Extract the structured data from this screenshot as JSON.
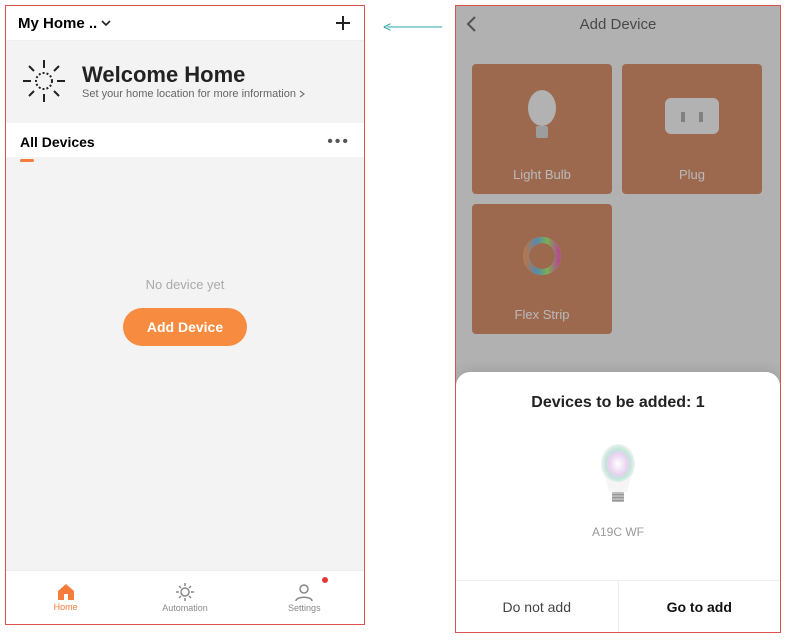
{
  "left": {
    "home_label": "My Home ..",
    "welcome_title": "Welcome Home",
    "welcome_subtitle": "Set your home location for more information",
    "tab": "All Devices",
    "empty_label": "No device yet",
    "add_button": "Add Device",
    "nav": {
      "home": "Home",
      "automation": "Automation",
      "settings": "Settings"
    }
  },
  "right": {
    "title": "Add Device",
    "tiles": [
      "Light Bulb",
      "Plug",
      "Flex Strip"
    ],
    "sheet_title": "Devices to be added: 1",
    "model": "A19C WF",
    "actions": {
      "cancel": "Do not add",
      "confirm": "Go to add"
    }
  }
}
